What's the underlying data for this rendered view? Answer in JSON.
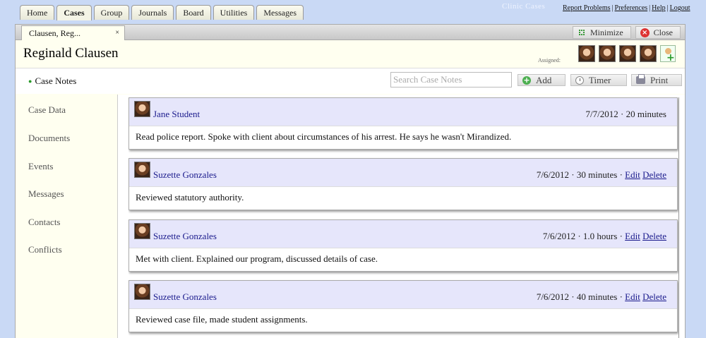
{
  "nav": {
    "tabs": [
      "Home",
      "Cases",
      "Group",
      "Journals",
      "Board",
      "Utilities",
      "Messages"
    ],
    "active_tab": "Cases",
    "brand": "Clinic Cases",
    "links": [
      "Report Problems",
      "Preferences",
      "Help",
      "Logout"
    ]
  },
  "window": {
    "tab_label": "Clausen, Reg...",
    "tab_close": "×",
    "minimize_label": "Minimize",
    "close_label": "Close",
    "case_title": "Reginald Clausen",
    "assigned_label": "Assigned:"
  },
  "toolbar": {
    "section_title": "Case Notes",
    "search_placeholder": "Search Case Notes",
    "add_label": "Add",
    "timer_label": "Timer",
    "print_label": "Print"
  },
  "sidebar": {
    "items": [
      "Case Data",
      "Documents",
      "Events",
      "Messages",
      "Contacts",
      "Conflicts"
    ]
  },
  "notes": [
    {
      "author": "Jane Student",
      "date": "7/7/2012",
      "duration": "20 minutes",
      "editable": false,
      "text": "Read police report. Spoke with client about circumstances of his arrest. He says he wasn't Mirandized."
    },
    {
      "author": "Suzette Gonzales",
      "date": "7/6/2012",
      "duration": "30 minutes",
      "editable": true,
      "text": "Reviewed statutory authority."
    },
    {
      "author": "Suzette Gonzales",
      "date": "7/6/2012",
      "duration": "1.0 hours",
      "editable": true,
      "text": "Met with client. Explained our program, discussed details of case."
    },
    {
      "author": "Suzette Gonzales",
      "date": "7/6/2012",
      "duration": "40 minutes",
      "editable": true,
      "text": "Reviewed case file, made student assignments."
    }
  ],
  "note_actions": {
    "edit": "Edit",
    "delete": "Delete",
    "separator": "·"
  },
  "colors": {
    "background": "#c9d9f5",
    "note_header": "#e6e6fb",
    "panel": "#fffff0",
    "link": "#1a1a8c"
  }
}
